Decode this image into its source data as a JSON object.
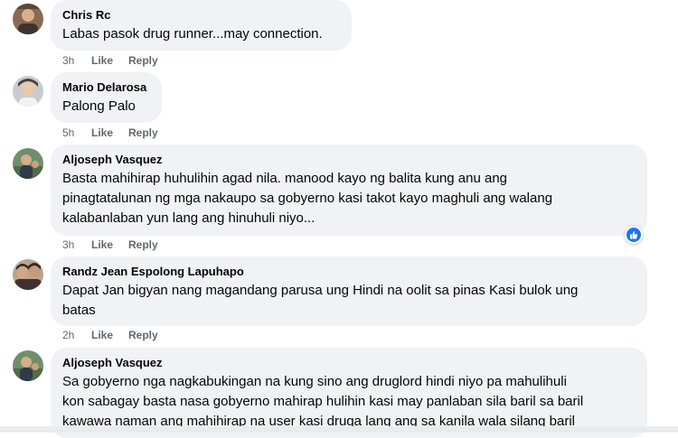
{
  "comments": [
    {
      "author": "Chris Rc",
      "lines": [
        "Labas pasok drug runner...may connection."
      ],
      "time": "3h",
      "like": "Like",
      "reply": "Reply"
    },
    {
      "author": "Mario Delarosa",
      "lines": [
        "Palong Palo"
      ],
      "time": "5h",
      "like": "Like",
      "reply": "Reply"
    },
    {
      "author": "Aljoseph Vasquez",
      "lines": [
        "Basta mahihirap huhulihin agad nila. manood kayo ng balita kung anu ang",
        "pinagtatalunan ng mga nakaupo sa gobyerno kasi takot kayo maghuli ang walang",
        "kalabanlaban yun lang ang hinuhuli niyo..."
      ],
      "time": "3h",
      "like": "Like",
      "reply": "Reply",
      "reaction": "like-reaction-icon"
    },
    {
      "author": "Randz Jean Espolong Lapuhapo",
      "lines": [
        "Dapat Jan bigyan nang magandang parusa ung Hindi na oolit sa pinas Kasi bulok ung",
        "batas"
      ],
      "time": "2h",
      "like": "Like",
      "reply": "Reply"
    },
    {
      "author": "Aljoseph Vasquez",
      "lines": [
        "Sa gobyerno nga nagkabukingan na kung sino ang druglord hindi niyo pa mahulihuli",
        "kon sabagay basta nasa gobyerno mahirap hulihin kasi may panlaban sila baril sa baril",
        "kawawa naman ang mahihirap na user kasi druga lang ang sa kanila wala silang baril"
      ]
    }
  ],
  "colors": {
    "bubble": "#f0f2f5",
    "meta": "#65676b",
    "reaction_blue": "#1877f2"
  }
}
